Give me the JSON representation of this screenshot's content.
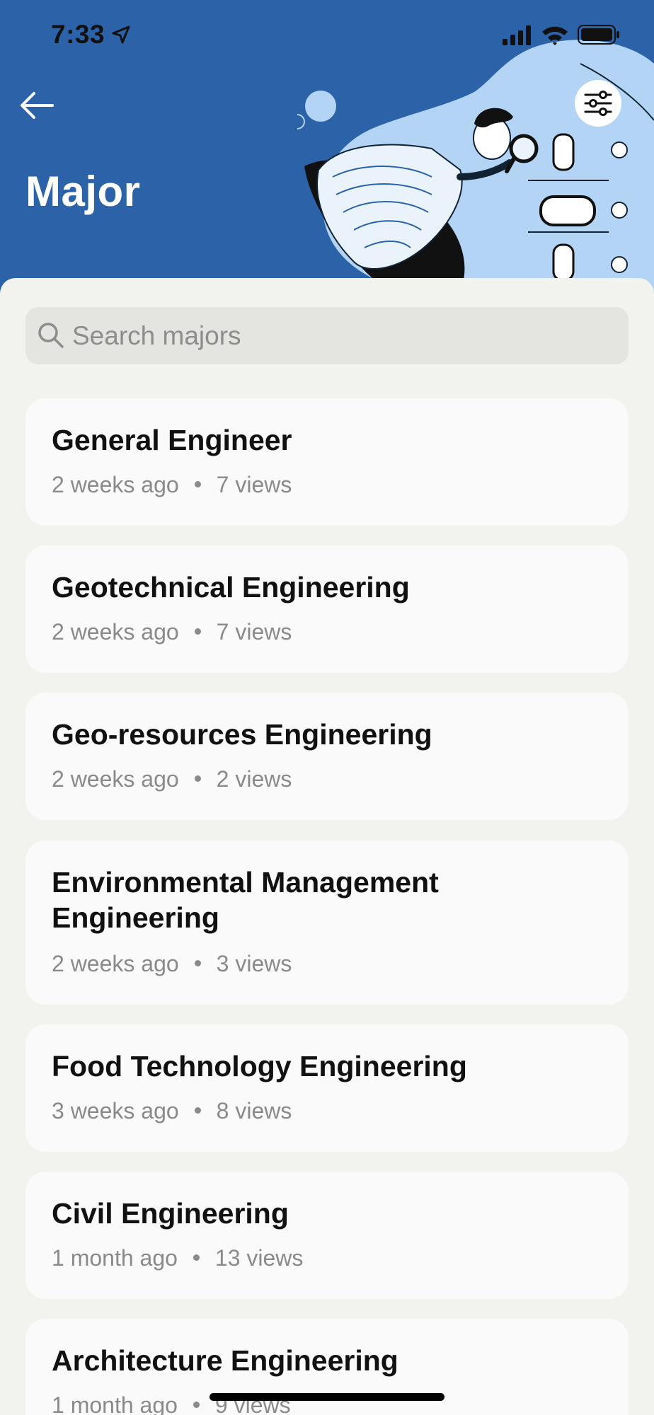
{
  "status_bar": {
    "time": "7:33"
  },
  "header": {
    "title": "Major"
  },
  "search": {
    "placeholder": "Search majors"
  },
  "majors": [
    {
      "title": "General Engineer",
      "age": "2 weeks ago",
      "views": "7 views"
    },
    {
      "title": "Geotechnical Engineering",
      "age": "2 weeks ago",
      "views": "7 views"
    },
    {
      "title": "Geo-resources Engineering",
      "age": "2 weeks ago",
      "views": "2 views"
    },
    {
      "title": "Environmental Management Engineering",
      "age": "2 weeks ago",
      "views": "3 views"
    },
    {
      "title": "Food Technology Engineering",
      "age": "3 weeks ago",
      "views": "8 views"
    },
    {
      "title": "Civil Engineering",
      "age": "1 month ago",
      "views": "13 views"
    },
    {
      "title": "Architecture Engineering",
      "age": "1 month ago",
      "views": "9 views"
    }
  ],
  "icons": [
    "location-arrow-icon",
    "signal-icon",
    "wifi-icon",
    "battery-icon",
    "back-arrow-icon",
    "filter-sliders-icon",
    "search-icon"
  ],
  "colors": {
    "header": "#2b62a8",
    "background": "#f2f2ef",
    "card": "#fafafa",
    "illustration_blob": "#b3d4f5"
  }
}
